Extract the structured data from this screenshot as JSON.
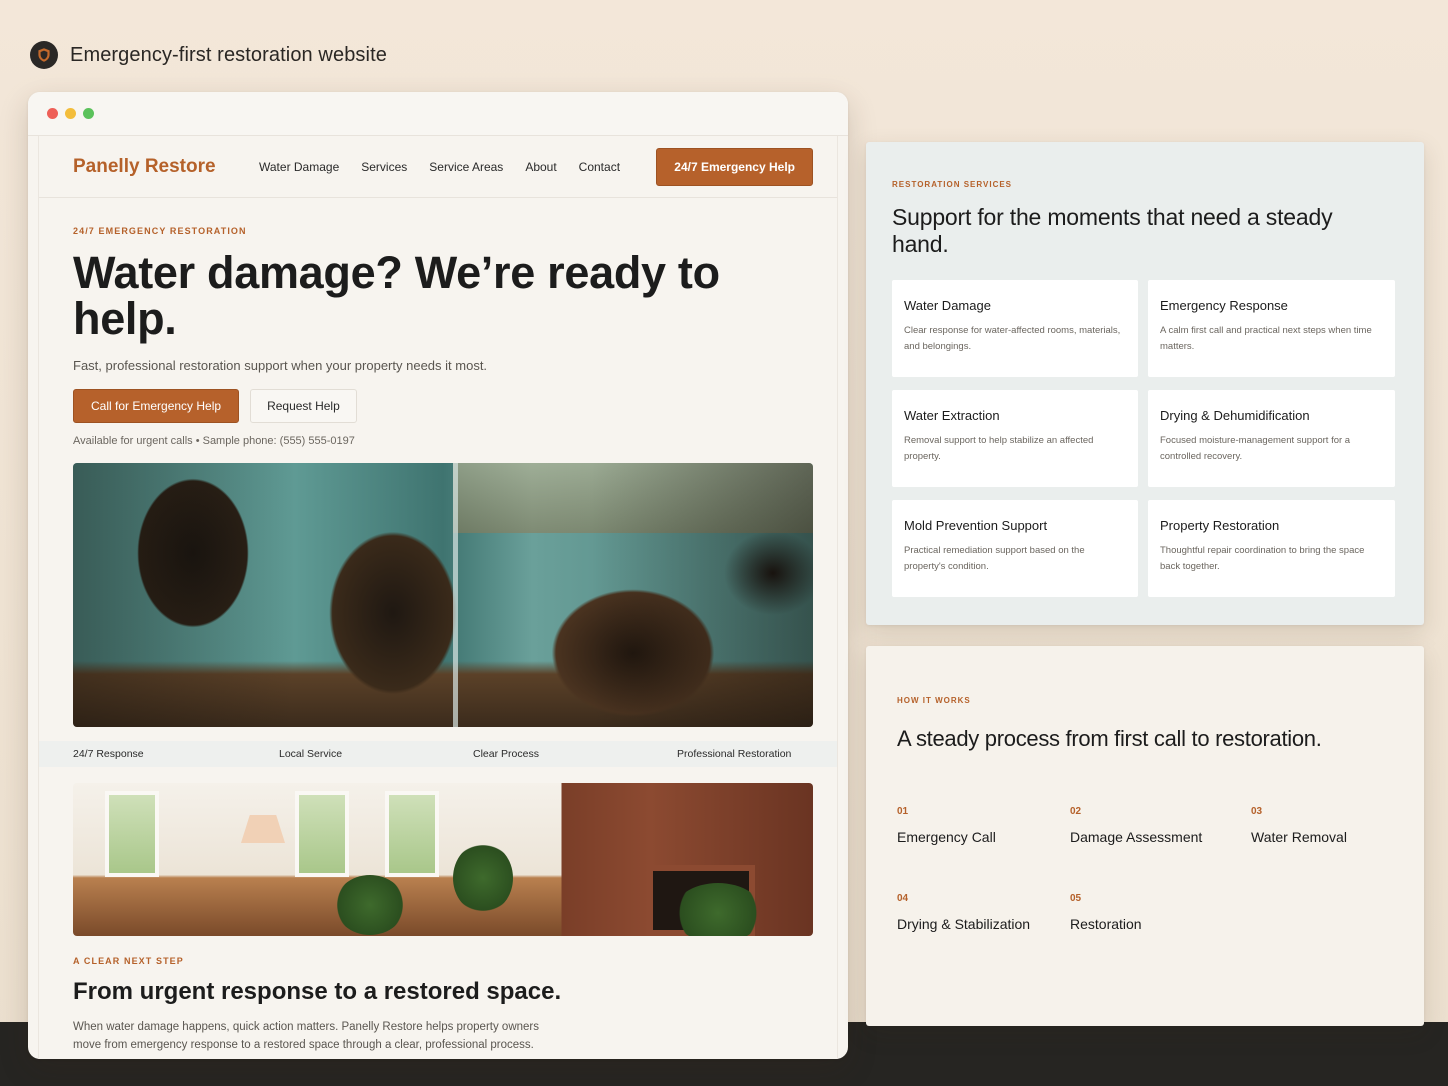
{
  "caption": {
    "title": "Emergency-first restoration website",
    "icon": "shield-icon"
  },
  "site": {
    "brand": "Panelly Restore",
    "nav": [
      "Water Damage",
      "Services",
      "Service Areas",
      "About",
      "Contact"
    ],
    "nav_cta": "24/7 Emergency Help",
    "hero": {
      "eyebrow": "24/7 EMERGENCY RESTORATION",
      "title": "Water damage? We’re ready to help.",
      "lede": "Fast, professional restoration support when your property needs it most.",
      "primary_cta": "Call for Emergency Help",
      "secondary_cta": "Request Help",
      "availability": "Available for urgent calls • Sample phone: (555) 555-0197"
    },
    "features": [
      "24/7 Response",
      "Local Service",
      "Clear Process",
      "Professional Restoration"
    ],
    "next": {
      "eyebrow": "A CLEAR NEXT STEP",
      "title": "From urgent response to a restored space.",
      "body": "When water damage happens, quick action matters. Panelly Restore helps property owners move from emergency response to a restored space through a clear, professional process."
    }
  },
  "services": {
    "eyebrow": "RESTORATION SERVICES",
    "title": "Support for the moments that need a steady hand.",
    "cards": [
      {
        "title": "Water Damage",
        "desc": "Clear response for water-affected rooms, materials, and belongings."
      },
      {
        "title": "Emergency Response",
        "desc": "A calm first call and practical next steps when time matters."
      },
      {
        "title": "Water Extraction",
        "desc": "Removal support to help stabilize an affected property."
      },
      {
        "title": "Drying & Dehumidification",
        "desc": "Focused moisture-management support for a controlled recovery."
      },
      {
        "title": "Mold Prevention Support",
        "desc": "Practical remediation support based on the property's condition."
      },
      {
        "title": "Property Restoration",
        "desc": "Thoughtful repair coordination to bring the space back together."
      }
    ]
  },
  "process": {
    "eyebrow": "HOW IT WORKS",
    "title": "A steady process from first call to restoration.",
    "steps": [
      {
        "num": "01",
        "label": "Emergency Call"
      },
      {
        "num": "02",
        "label": "Damage Assessment"
      },
      {
        "num": "03",
        "label": "Water Removal"
      },
      {
        "num": "04",
        "label": "Drying & Stabilization"
      },
      {
        "num": "05",
        "label": "Restoration"
      }
    ]
  },
  "colors": {
    "accent": "#b6612b",
    "dark": "#262522",
    "panel_blue": "#eaeeed",
    "panel_cream": "#f6f2eb"
  }
}
